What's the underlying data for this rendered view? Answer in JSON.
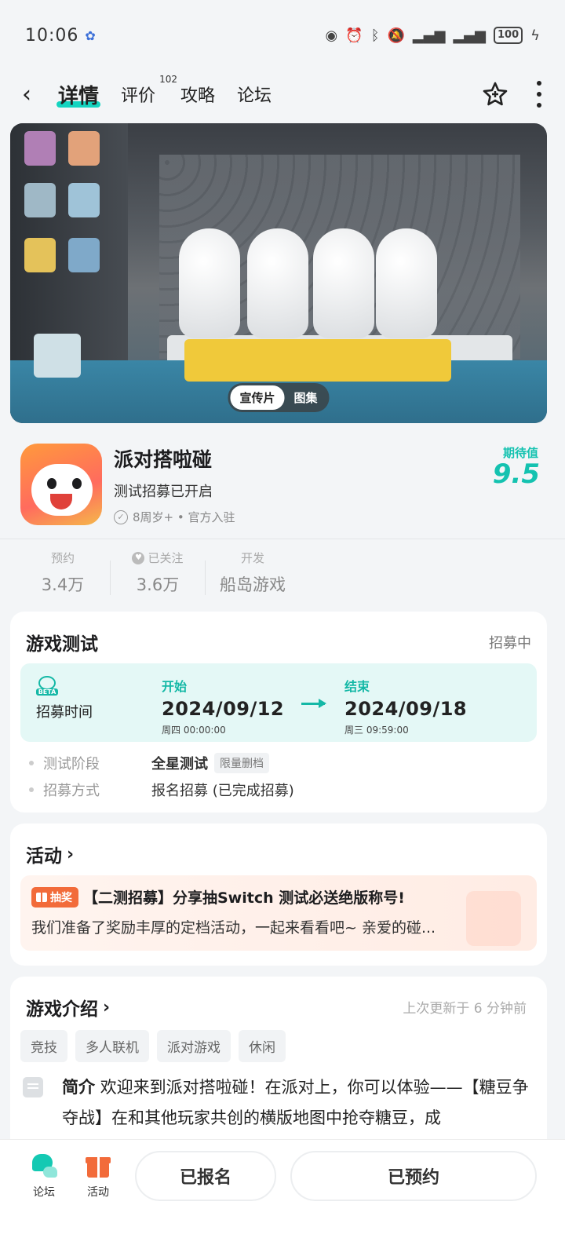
{
  "status_bar": {
    "time": "10:06",
    "battery": "100"
  },
  "nav": {
    "tabs": [
      {
        "label": "详情",
        "badge": ""
      },
      {
        "label": "评价",
        "badge": "102"
      },
      {
        "label": "攻略",
        "badge": ""
      },
      {
        "label": "论坛",
        "badge": ""
      }
    ]
  },
  "banner": {
    "toggle": [
      "宣传片",
      "图集"
    ]
  },
  "app": {
    "name": "派对搭啦碰",
    "subtitle": "测试招募已开启",
    "meta": "8周岁+ • 官方入驻",
    "rating_label": "期待值",
    "rating_value": "9.5"
  },
  "stats": [
    {
      "label": "预约",
      "value": "3.4万"
    },
    {
      "label": "已关注",
      "value": "3.6万"
    },
    {
      "label": "开发",
      "value": "船岛游戏"
    }
  ],
  "test": {
    "title": "游戏测试",
    "status": "招募中",
    "recruit_label": "招募时间",
    "start_label": "开始",
    "start_date": "2024/09/12",
    "start_time": "周四 00:00:00",
    "end_label": "结束",
    "end_date": "2024/09/18",
    "end_time": "周三 09:59:00",
    "rows": [
      {
        "key": "测试阶段",
        "value": "全星测试",
        "tag": "限量删档"
      },
      {
        "key": "招募方式",
        "value": "报名招募 (已完成招募)"
      }
    ]
  },
  "activity": {
    "title": "活动",
    "badge": "抽奖",
    "headline": "【二测招募】分享抽Switch 测试必送绝版称号!",
    "desc": "我们准备了奖励丰厚的定档活动，一起来看看吧~ 亲爱的碰..."
  },
  "intro": {
    "title": "游戏介绍",
    "updated": "上次更新于 6 分钟前",
    "tags": [
      "竞技",
      "多人联机",
      "派对游戏",
      "休闲"
    ],
    "label": "简介",
    "text": "欢迎来到派对搭啦碰！在派对上，你可以体验——【糖豆争夺战】在和其他玩家共创的横版地图中抢夺糖豆，成"
  },
  "bottom": {
    "forum": "论坛",
    "activity": "活动",
    "signed_up": "已报名",
    "reserved": "已预约"
  },
  "colors": {
    "accent": "#14c2b0",
    "orange": "#f26b3a"
  }
}
